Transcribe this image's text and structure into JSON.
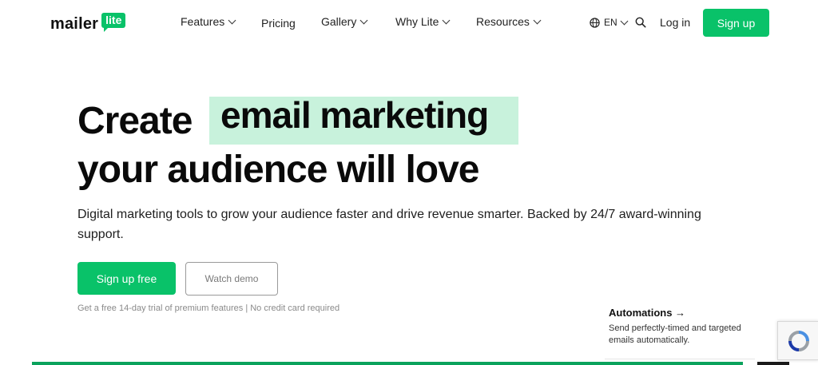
{
  "header": {
    "logo": {
      "word": "mailer",
      "badge": "lite"
    },
    "nav": [
      {
        "label": "Features",
        "has_dropdown": true
      },
      {
        "label": "Pricing",
        "has_dropdown": false
      },
      {
        "label": "Gallery",
        "has_dropdown": true
      },
      {
        "label": "Why Lite",
        "has_dropdown": true
      },
      {
        "label": "Resources",
        "has_dropdown": true
      }
    ],
    "language": "EN",
    "login_label": "Log in",
    "signup_label": "Sign up"
  },
  "hero": {
    "line1": "Create",
    "highlight": "email marketing",
    "line2": "your audience will love",
    "subtitle": "Digital marketing tools to grow your audience faster and drive revenue smarter. Backed by 24/7 award-winning support.",
    "primary_cta": "Sign up free",
    "secondary_cta": "Watch demo",
    "trial_note": "Get a free 14-day trial of premium features | No credit card required"
  },
  "feature_card": {
    "title": "Automations →",
    "description": "Send perfectly-timed and targeted emails automatically."
  },
  "colors": {
    "brand_green": "#09c269",
    "highlight_green": "#c8f2dc",
    "text": "#111111"
  },
  "icons": [
    "globe-icon",
    "chevron-down-icon",
    "search-icon",
    "recaptcha-icon"
  ]
}
